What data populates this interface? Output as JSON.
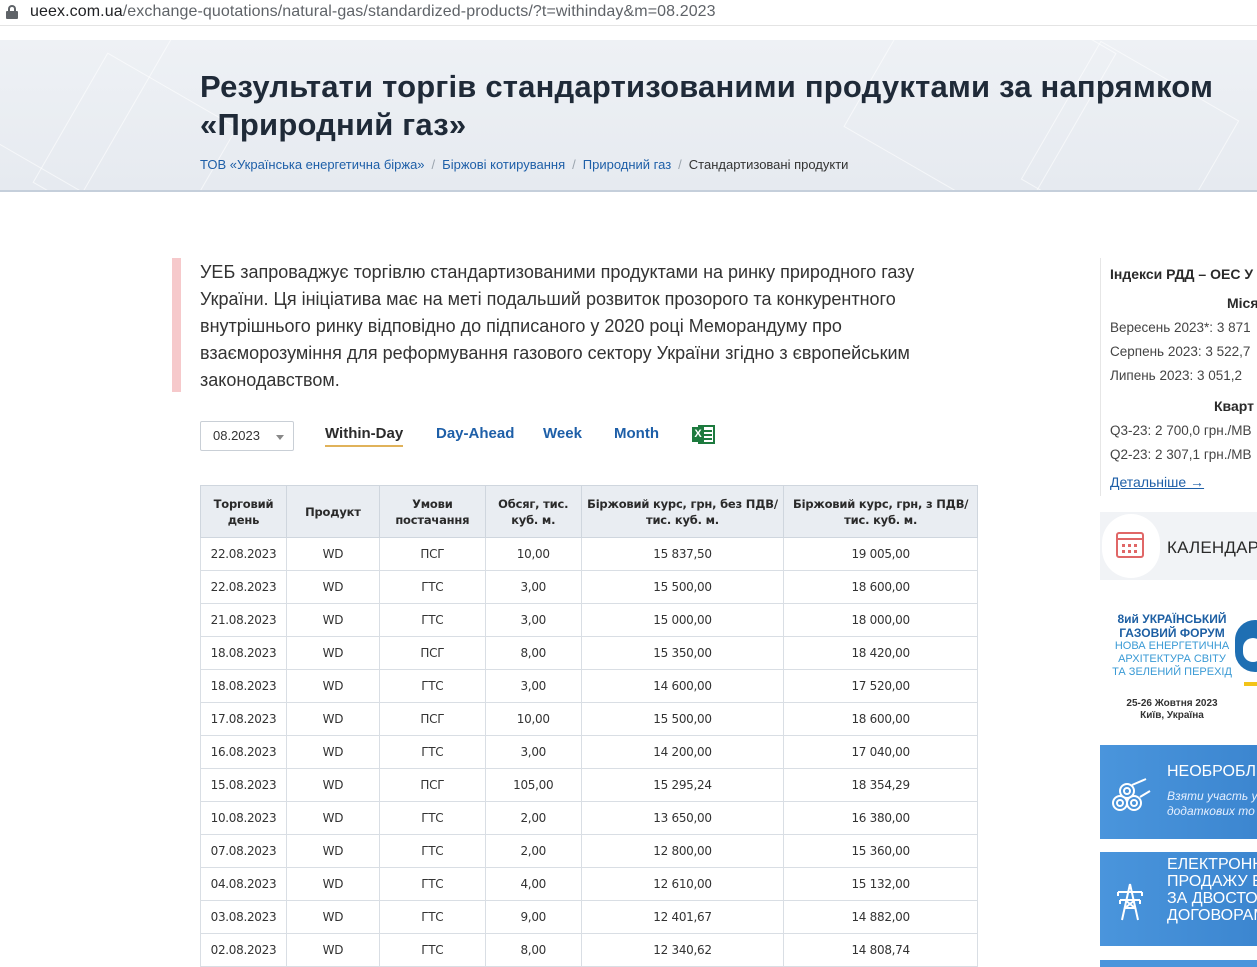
{
  "browser": {
    "url_host": "ueex.com.ua",
    "url_path": "/exchange-quotations/natural-gas/standardized-products/?t=withinday&m=08.2023"
  },
  "header": {
    "title": "Результати торгів стандартизованими продуктами за напрямком «Природний газ»",
    "breadcrumbs": [
      "ТОВ «Українська енергетична біржа»",
      "Біржові котирування",
      "Природний газ",
      "Стандартизовані продукти"
    ]
  },
  "intro": {
    "text": "УЕБ запроваджує торгівлю стандартизованими продуктами на ринку природного газу України. Ця ініціатива має на меті подальший розвиток прозорого та конкурентного внутрішнього ринку відповідно до підписаного у 2020 році Меморандуму про взаєморозуміння для реформування газового сектору України згідно з європейським законодавством."
  },
  "controls": {
    "month_value": "08.2023",
    "tabs": [
      "Within-Day",
      "Day-Ahead",
      "Week",
      "Month"
    ],
    "active_tab": "Within-Day",
    "excel_icon": "excel-export-icon"
  },
  "table": {
    "headers": [
      "Торговий день",
      "Продукт",
      "Умови постачання",
      "Обсяг, тис. куб. м.",
      "Біржовий курс, грн, без ПДВ/тис. куб. м.",
      "Біржовий курс, грн, з ПДВ/тис. куб. м."
    ],
    "rows": [
      [
        "22.08.2023",
        "WD",
        "ПСГ",
        "10,00",
        "15 837,50",
        "19 005,00"
      ],
      [
        "22.08.2023",
        "WD",
        "ГТС",
        "3,00",
        "15 500,00",
        "18 600,00"
      ],
      [
        "21.08.2023",
        "WD",
        "ГТС",
        "3,00",
        "15 000,00",
        "18 000,00"
      ],
      [
        "18.08.2023",
        "WD",
        "ПСГ",
        "8,00",
        "15 350,00",
        "18 420,00"
      ],
      [
        "18.08.2023",
        "WD",
        "ГТС",
        "3,00",
        "14 600,00",
        "17 520,00"
      ],
      [
        "17.08.2023",
        "WD",
        "ПСГ",
        "10,00",
        "15 500,00",
        "18 600,00"
      ],
      [
        "16.08.2023",
        "WD",
        "ГТС",
        "3,00",
        "14 200,00",
        "17 040,00"
      ],
      [
        "15.08.2023",
        "WD",
        "ПСГ",
        "105,00",
        "15 295,24",
        "18 354,29"
      ],
      [
        "10.08.2023",
        "WD",
        "ГТС",
        "2,00",
        "13 650,00",
        "16 380,00"
      ],
      [
        "07.08.2023",
        "WD",
        "ГТС",
        "2,00",
        "12 800,00",
        "15 360,00"
      ],
      [
        "04.08.2023",
        "WD",
        "ГТС",
        "4,00",
        "12 610,00",
        "15 132,00"
      ],
      [
        "03.08.2023",
        "WD",
        "ГТС",
        "9,00",
        "12 401,67",
        "14 882,00"
      ],
      [
        "02.08.2023",
        "WD",
        "ГТС",
        "8,00",
        "12 340,62",
        "14 808,74"
      ]
    ]
  },
  "sidebar": {
    "rdd_title": "Індекси РДД – ОЕС У",
    "rdd_month_heading": "Міся",
    "rdd_month_rows": [
      "Вересень 2023*: 3 871",
      "Серпень 2023: 3 522,7",
      "Липень 2023: 3 051,2"
    ],
    "rdd_quarter_heading": "Кварт",
    "rdd_quarter_rows": [
      "Q3-23: 2 700,0 грн./МВ",
      "Q2-23: 2 307,1 грн./МВ"
    ],
    "rdd_more": "Детальніше →",
    "calendar_label": "КАЛЕНДАР ТО",
    "forum_title_lines": [
      "8ий УКРАЇНСЬКИЙ",
      "ГАЗОВИЙ ФОРУМ"
    ],
    "forum_sub_lines": [
      "НОВА ЕНЕРГЕТИЧНА",
      "АРХІТЕКТУРА СВІТУ",
      "ТА ЗЕЛЕНИЙ ПЕРЕХІД"
    ],
    "forum_date_lines": [
      "25-26 Жовтня 2023",
      "Київ, Україна"
    ],
    "promo1_title": "НЕОБРОБЛЕН",
    "promo1_sub_lines": [
      "Взяти участь у",
      "додаткових то"
    ],
    "promo2_title_lines": [
      "ЕЛЕКТРОННІ",
      "ПРОДАЖУ ЕЛ",
      "ЗА ДВОСТОРО",
      "ДОГОВОРАМИ"
    ],
    "colors": {
      "accent": "#1e5fa8",
      "quote_bar": "#f6c9cb",
      "excel_green": "#1d7a3e",
      "promo_blue": "#4a95dc"
    }
  }
}
